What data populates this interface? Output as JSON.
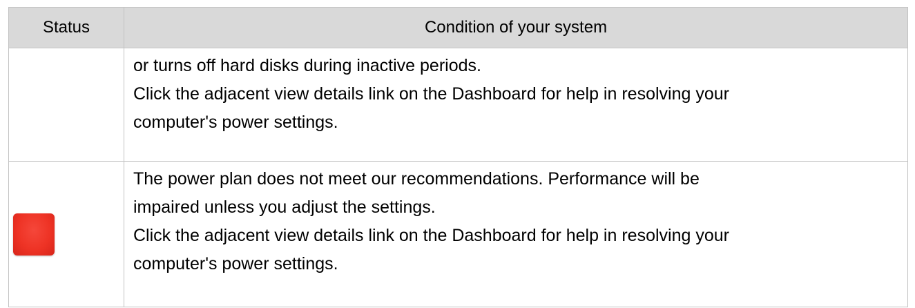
{
  "table": {
    "headers": {
      "status": "Status",
      "condition": "Condition of your system"
    },
    "rows": [
      {
        "status_indicator": "none",
        "lines": [
          "or turns off hard disks during inactive periods.",
          "Click the adjacent view details link on the Dashboard for help in resolving your",
          "computer's power settings."
        ]
      },
      {
        "status_indicator": "red-square-icon",
        "status_color": "#ee3325",
        "lines": [
          "The power plan does not meet our recommendations. Performance will be",
          "impaired unless you adjust the settings.",
          "Click the adjacent view details link on the Dashboard for help in resolving your",
          "computer's power settings."
        ]
      }
    ]
  }
}
